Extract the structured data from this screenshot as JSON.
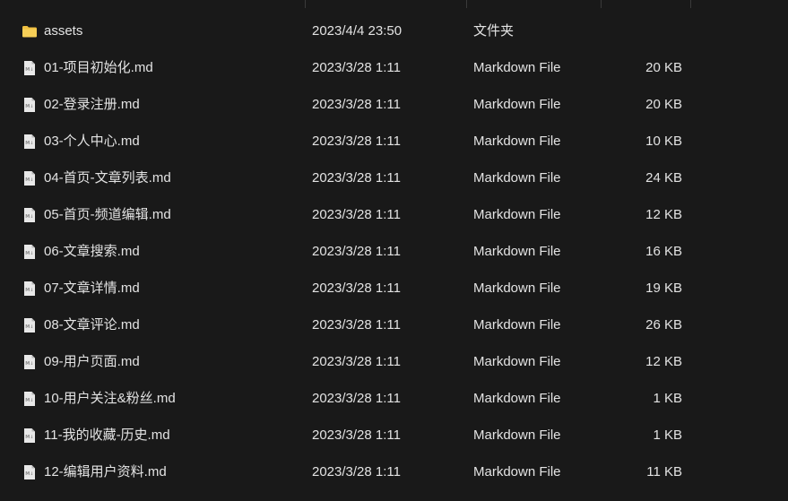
{
  "colors": {
    "background": "#191919",
    "text": "#e3e3e3",
    "folder": "#f0c041",
    "doc": "#e8e8e8"
  },
  "files": [
    {
      "name": "assets",
      "date": "2023/4/4 23:50",
      "type": "文件夹",
      "size": "",
      "icon": "folder-icon"
    },
    {
      "name": "01-项目初始化.md",
      "date": "2023/3/28 1:11",
      "type": "Markdown File",
      "size": "20 KB",
      "icon": "markdown-file-icon"
    },
    {
      "name": "02-登录注册.md",
      "date": "2023/3/28 1:11",
      "type": "Markdown File",
      "size": "20 KB",
      "icon": "markdown-file-icon"
    },
    {
      "name": "03-个人中心.md",
      "date": "2023/3/28 1:11",
      "type": "Markdown File",
      "size": "10 KB",
      "icon": "markdown-file-icon"
    },
    {
      "name": "04-首页-文章列表.md",
      "date": "2023/3/28 1:11",
      "type": "Markdown File",
      "size": "24 KB",
      "icon": "markdown-file-icon"
    },
    {
      "name": "05-首页-频道编辑.md",
      "date": "2023/3/28 1:11",
      "type": "Markdown File",
      "size": "12 KB",
      "icon": "markdown-file-icon"
    },
    {
      "name": "06-文章搜索.md",
      "date": "2023/3/28 1:11",
      "type": "Markdown File",
      "size": "16 KB",
      "icon": "markdown-file-icon"
    },
    {
      "name": "07-文章详情.md",
      "date": "2023/3/28 1:11",
      "type": "Markdown File",
      "size": "19 KB",
      "icon": "markdown-file-icon"
    },
    {
      "name": "08-文章评论.md",
      "date": "2023/3/28 1:11",
      "type": "Markdown File",
      "size": "26 KB",
      "icon": "markdown-file-icon"
    },
    {
      "name": "09-用户页面.md",
      "date": "2023/3/28 1:11",
      "type": "Markdown File",
      "size": "12 KB",
      "icon": "markdown-file-icon"
    },
    {
      "name": "10-用户关注&粉丝.md",
      "date": "2023/3/28 1:11",
      "type": "Markdown File",
      "size": "1 KB",
      "icon": "markdown-file-icon"
    },
    {
      "name": "11-我的收藏-历史.md",
      "date": "2023/3/28 1:11",
      "type": "Markdown File",
      "size": "1 KB",
      "icon": "markdown-file-icon"
    },
    {
      "name": "12-编辑用户资料.md",
      "date": "2023/3/28 1:11",
      "type": "Markdown File",
      "size": "11 KB",
      "icon": "markdown-file-icon"
    }
  ]
}
